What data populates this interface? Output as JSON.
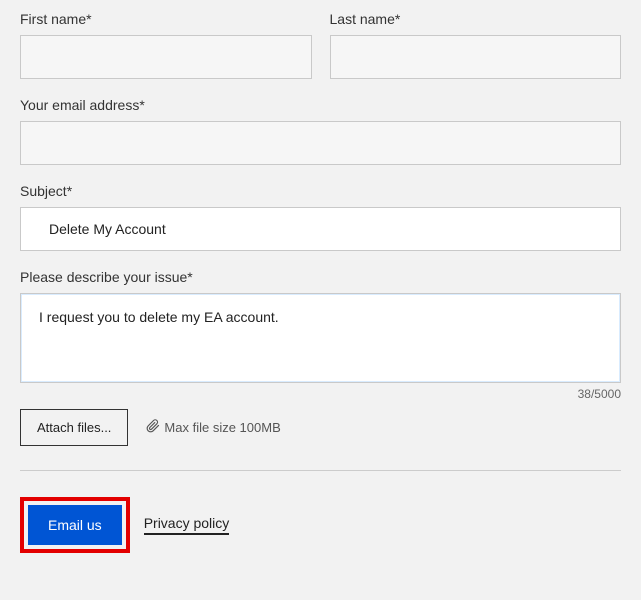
{
  "labels": {
    "first_name": "First name*",
    "last_name": "Last name*",
    "email": "Your email address*",
    "subject": "Subject*",
    "description": "Please describe your issue*"
  },
  "values": {
    "first_name": "",
    "last_name": "",
    "email": "",
    "subject": "Delete My Account",
    "description": "I request you to delete my EA account."
  },
  "counter": "38/5000",
  "attach": {
    "button": "Attach files...",
    "hint": "Max file size 100MB"
  },
  "submit": "Email us",
  "privacy": "Privacy policy"
}
